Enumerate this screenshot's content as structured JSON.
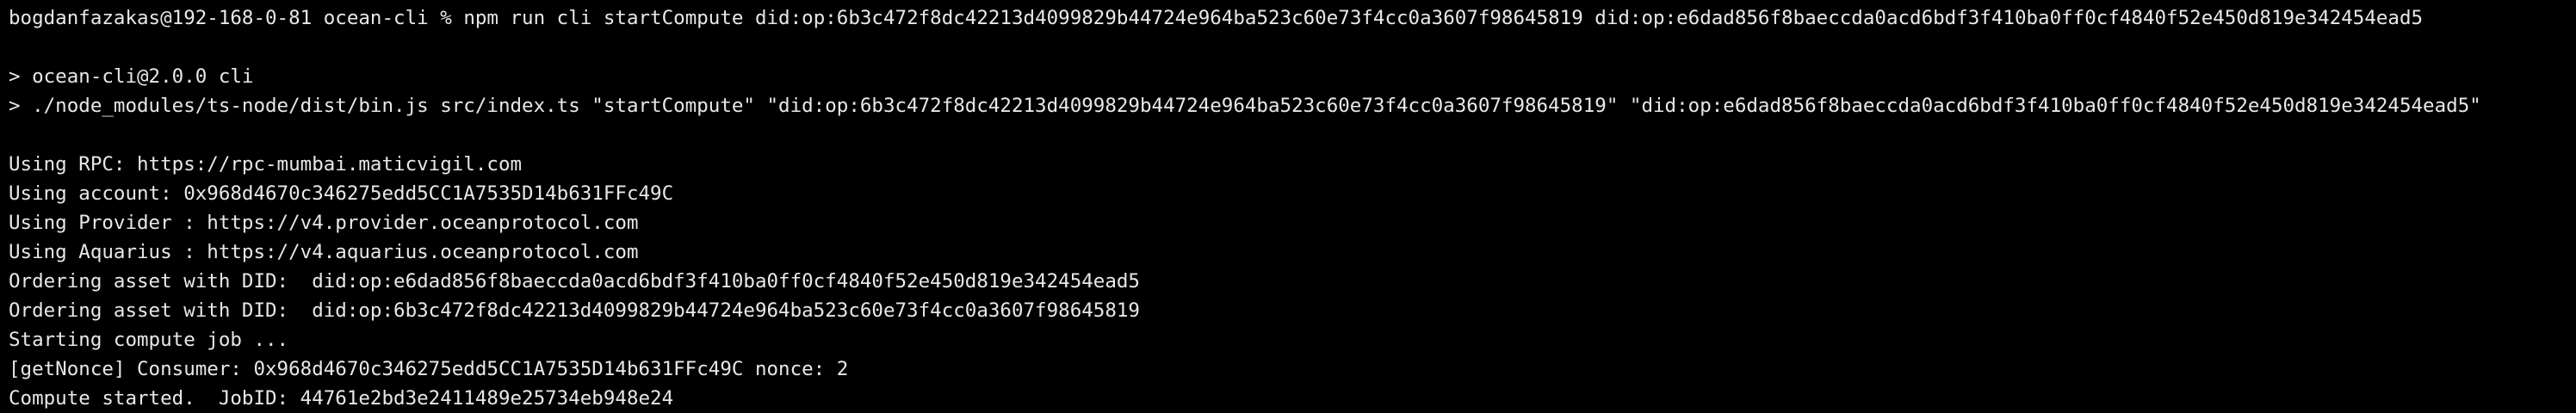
{
  "terminal": {
    "prompt_user_host": "bogdanfazakas@192-168-0-81",
    "prompt_dir": "ocean-cli",
    "prompt_symbol": "%",
    "command": "npm run cli startCompute did:op:6b3c472f8dc42213d4099829b44724e964ba523c60e73f4cc0a3607f98645819 did:op:e6dad856f8baeccda0acd6bdf3f410ba0ff0cf4840f52e450d819e342454ead5",
    "script_name_line": "> ocean-cli@2.0.0 cli",
    "script_exec_line": "> ./node_modules/ts-node/dist/bin.js src/index.ts \"startCompute\" \"did:op:6b3c472f8dc42213d4099829b44724e964ba523c60e73f4cc0a3607f98645819\" \"did:op:e6dad856f8baeccda0acd6bdf3f410ba0ff0cf4840f52e450d819e342454ead5\"",
    "output": [
      "Using RPC: https://rpc-mumbai.maticvigil.com",
      "Using account: 0x968d4670c346275edd5CC1A7535D14b631FFc49C",
      "Using Provider : https://v4.provider.oceanprotocol.com",
      "Using Aquarius : https://v4.aquarius.oceanprotocol.com",
      "Ordering asset with DID:  did:op:e6dad856f8baeccda0acd6bdf3f410ba0ff0cf4840f52e450d819e342454ead5",
      "Ordering asset with DID:  did:op:6b3c472f8dc42213d4099829b44724e964ba523c60e73f4cc0a3607f98645819",
      "Starting compute job ...",
      "[getNonce] Consumer: 0x968d4670c346275edd5CC1A7535D14b631FFc49C nonce: 2",
      "Compute started.  JobID: 44761e2bd3e2411489e25734eb948e24"
    ]
  },
  "colors": {
    "background": "#000000",
    "text": "#e8e8e8"
  }
}
